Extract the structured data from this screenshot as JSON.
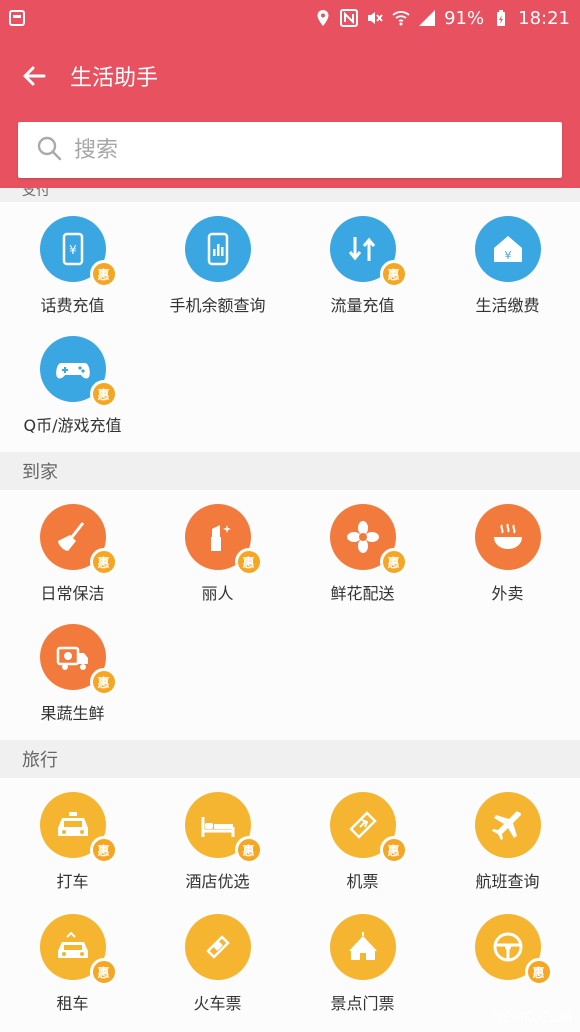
{
  "status_bar": {
    "battery": "91%",
    "time": "18:21"
  },
  "app_bar": {
    "title": "生活助手"
  },
  "search": {
    "placeholder": "搜索"
  },
  "sections": [
    {
      "name": "支付",
      "items": [
        {
          "label": "话费充值",
          "icon": "phone-yuan-icon",
          "badge": "惠",
          "color": "#3aa7e3"
        },
        {
          "label": "手机余额查询",
          "icon": "phone-chart-icon",
          "badge": "",
          "color": "#3aa7e3"
        },
        {
          "label": "流量充值",
          "icon": "data-arrows-icon",
          "badge": "惠",
          "color": "#3aa7e3"
        },
        {
          "label": "生活缴费",
          "icon": "house-yuan-icon",
          "badge": "",
          "color": "#3aa7e3"
        },
        {
          "label": "Q币/游戏充值",
          "icon": "gamepad-icon",
          "badge": "惠",
          "color": "#3aa7e3"
        }
      ]
    },
    {
      "name": "到家",
      "items": [
        {
          "label": "日常保洁",
          "icon": "broom-icon",
          "badge": "惠",
          "color": "#f37a3d"
        },
        {
          "label": "丽人",
          "icon": "lipstick-icon",
          "badge": "惠",
          "color": "#f37a3d"
        },
        {
          "label": "鲜花配送",
          "icon": "flower-icon",
          "badge": "惠",
          "color": "#f37a3d"
        },
        {
          "label": "外卖",
          "icon": "food-bowl-icon",
          "badge": "",
          "color": "#f37a3d"
        },
        {
          "label": "果蔬生鲜",
          "icon": "delivery-truck-icon",
          "badge": "惠",
          "color": "#f37a3d"
        }
      ]
    },
    {
      "name": "旅行",
      "items": [
        {
          "label": "打车",
          "icon": "taxi-icon",
          "badge": "惠",
          "color": "#f5b531"
        },
        {
          "label": "酒店优选",
          "icon": "bed-icon",
          "badge": "惠",
          "color": "#f5b531"
        },
        {
          "label": "机票",
          "icon": "ticket-plane-icon",
          "badge": "惠",
          "color": "#f5b531"
        },
        {
          "label": "航班查询",
          "icon": "airplane-icon",
          "badge": "",
          "color": "#f5b531"
        },
        {
          "label": "租车",
          "icon": "car-rental-icon",
          "badge": "惠",
          "color": "#f5b531"
        },
        {
          "label": "火车票",
          "icon": "train-ticket-icon",
          "badge": "",
          "color": "#f5b531"
        },
        {
          "label": "景点门票",
          "icon": "tent-icon",
          "badge": "",
          "color": "#f5b531"
        },
        {
          "label": "",
          "icon": "steering-wheel-icon",
          "badge": "惠",
          "color": "#f5b531"
        }
      ]
    }
  ],
  "watermark": "YEMO.COM"
}
